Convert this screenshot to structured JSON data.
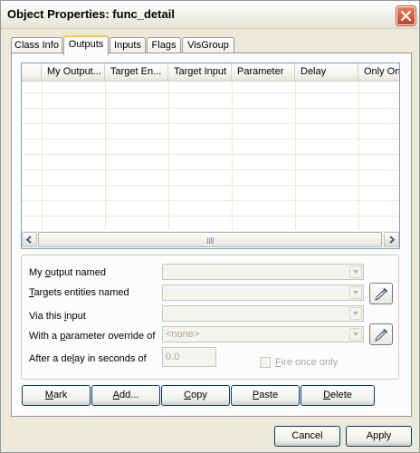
{
  "window": {
    "title": "Object Properties: func_detail"
  },
  "tabs": [
    {
      "label": "Class Info",
      "active": false
    },
    {
      "label": "Outputs",
      "active": true
    },
    {
      "label": "Inputs",
      "active": false
    },
    {
      "label": "Flags",
      "active": false
    },
    {
      "label": "VisGroup",
      "active": false
    }
  ],
  "list": {
    "columns": [
      "My Output...",
      "Target En...",
      "Target Input",
      "Parameter",
      "Delay",
      "Only On"
    ]
  },
  "form": {
    "output_label_pre": "My ",
    "output_label_u": "o",
    "output_label_post": "utput named",
    "targets_label_u": "T",
    "targets_label_post": "argets entities named",
    "input_label_pre": "Via this ",
    "input_label_u": "i",
    "input_label_post": "nput",
    "param_label_pre": "With a ",
    "param_label_u": "p",
    "param_label_post": "arameter override of",
    "param_value": "<none>",
    "delay_label_pre": "After a de",
    "delay_label_u": "l",
    "delay_label_post": "ay in seconds of",
    "delay_value": "0.0",
    "fire_once_pre": "",
    "fire_once_u": "F",
    "fire_once_post": "ire once only"
  },
  "actions": {
    "mark_u": "M",
    "mark_post": "ark",
    "add_u": "A",
    "add_post": "dd...",
    "copy_u": "C",
    "copy_post": "opy",
    "paste_u": "P",
    "paste_post": "aste",
    "delete_u": "D",
    "delete_post": "elete"
  },
  "footer": {
    "cancel": "Cancel",
    "apply": "Apply"
  }
}
